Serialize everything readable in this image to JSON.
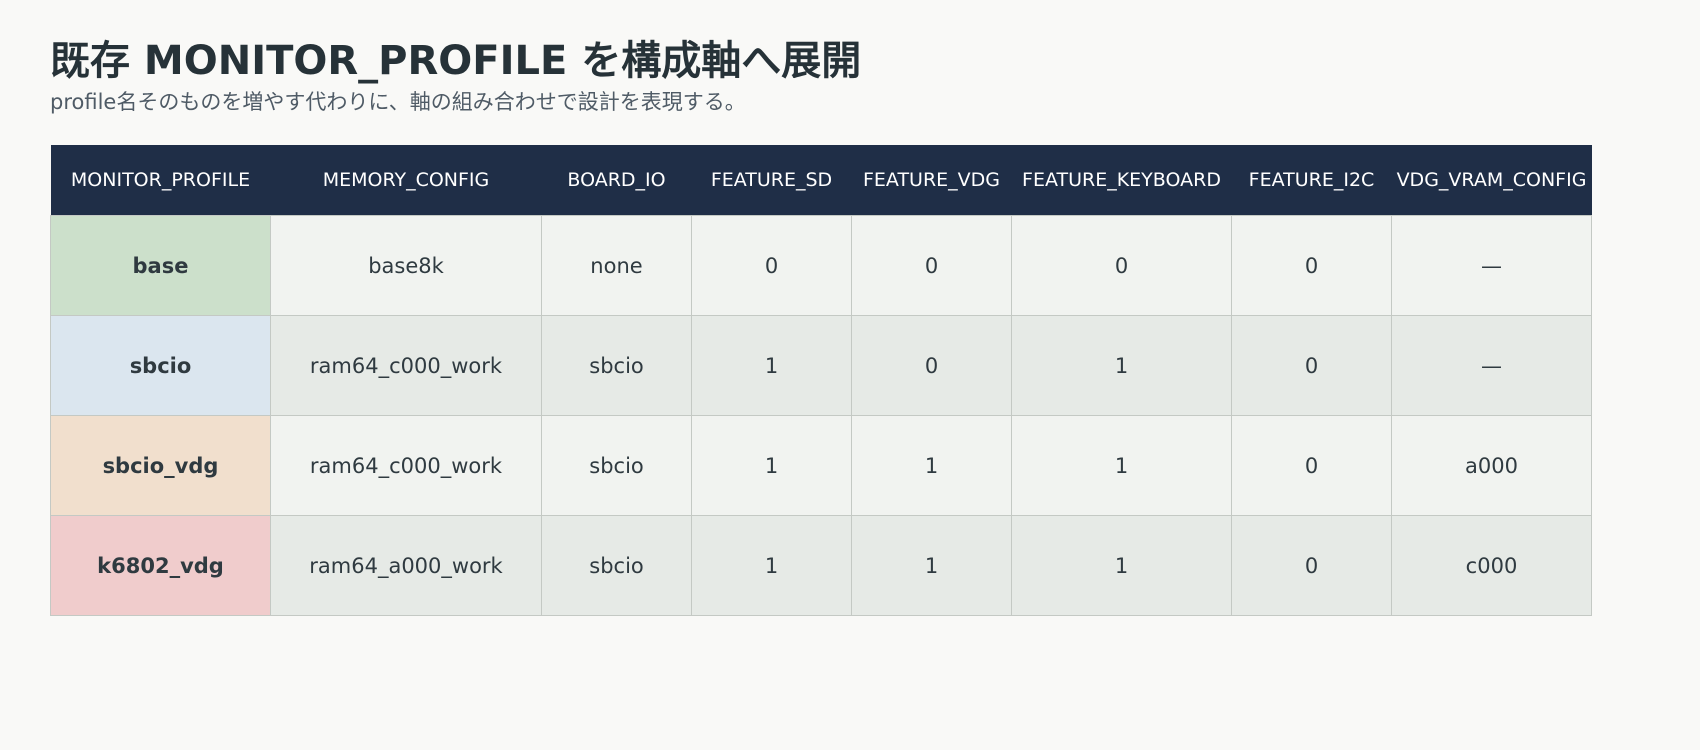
{
  "title": "既存 MONITOR_PROFILE を構成軸へ展開",
  "subtitle": "profile名そのものを増やす代わりに、軸の組み合わせで設計を表現する。",
  "table": {
    "headers": [
      "MONITOR_PROFILE",
      "MEMORY_CONFIG",
      "BOARD_IO",
      "FEATURE_SD",
      "FEATURE_VDG",
      "FEATURE_KEYBOARD",
      "FEATURE_I2C",
      "VDG_VRAM_CONFIG"
    ],
    "rows": [
      {
        "profile": "base",
        "color": "#cce0cb",
        "cells": [
          "base8k",
          "none",
          "0",
          "0",
          "0",
          "0",
          "—"
        ]
      },
      {
        "profile": "sbcio",
        "color": "#dbe6ef",
        "cells": [
          "ram64_c000_work",
          "sbcio",
          "1",
          "0",
          "1",
          "0",
          "—"
        ]
      },
      {
        "profile": "sbcio_vdg",
        "color": "#f1dfcd",
        "cells": [
          "ram64_c000_work",
          "sbcio",
          "1",
          "1",
          "1",
          "0",
          "a000"
        ]
      },
      {
        "profile": "k6802_vdg",
        "color": "#f0cccc",
        "cells": [
          "ram64_a000_work",
          "sbcio",
          "1",
          "1",
          "1",
          "0",
          "c000"
        ]
      }
    ]
  }
}
